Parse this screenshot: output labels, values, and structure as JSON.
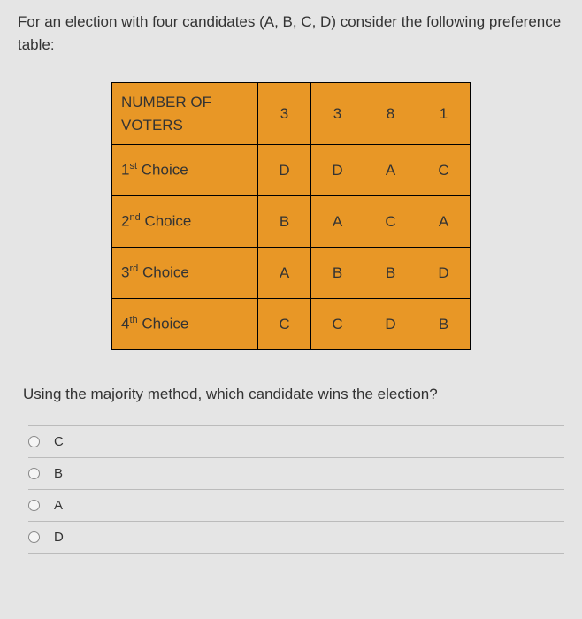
{
  "intro": "For an election with four candidates (A, B, C, D) consider the following preference table:",
  "table": {
    "header_label": "NUMBER OF VOTERS",
    "voters": [
      "3",
      "3",
      "8",
      "1"
    ],
    "rows": [
      {
        "ordinal": "1",
        "suffix": "st",
        "label": " Choice",
        "cells": [
          "D",
          "D",
          "A",
          "C"
        ]
      },
      {
        "ordinal": "2",
        "suffix": "nd",
        "label": " Choice",
        "cells": [
          "B",
          "A",
          "C",
          "A"
        ]
      },
      {
        "ordinal": "3",
        "suffix": "rd",
        "label": " Choice",
        "cells": [
          "A",
          "B",
          "B",
          "D"
        ]
      },
      {
        "ordinal": "4",
        "suffix": "th",
        "label": " Choice",
        "cells": [
          "C",
          "C",
          "D",
          "B"
        ]
      }
    ]
  },
  "question": "Using the majority method, which candidate wins the election?",
  "options": [
    "C",
    "B",
    "A",
    "D"
  ]
}
